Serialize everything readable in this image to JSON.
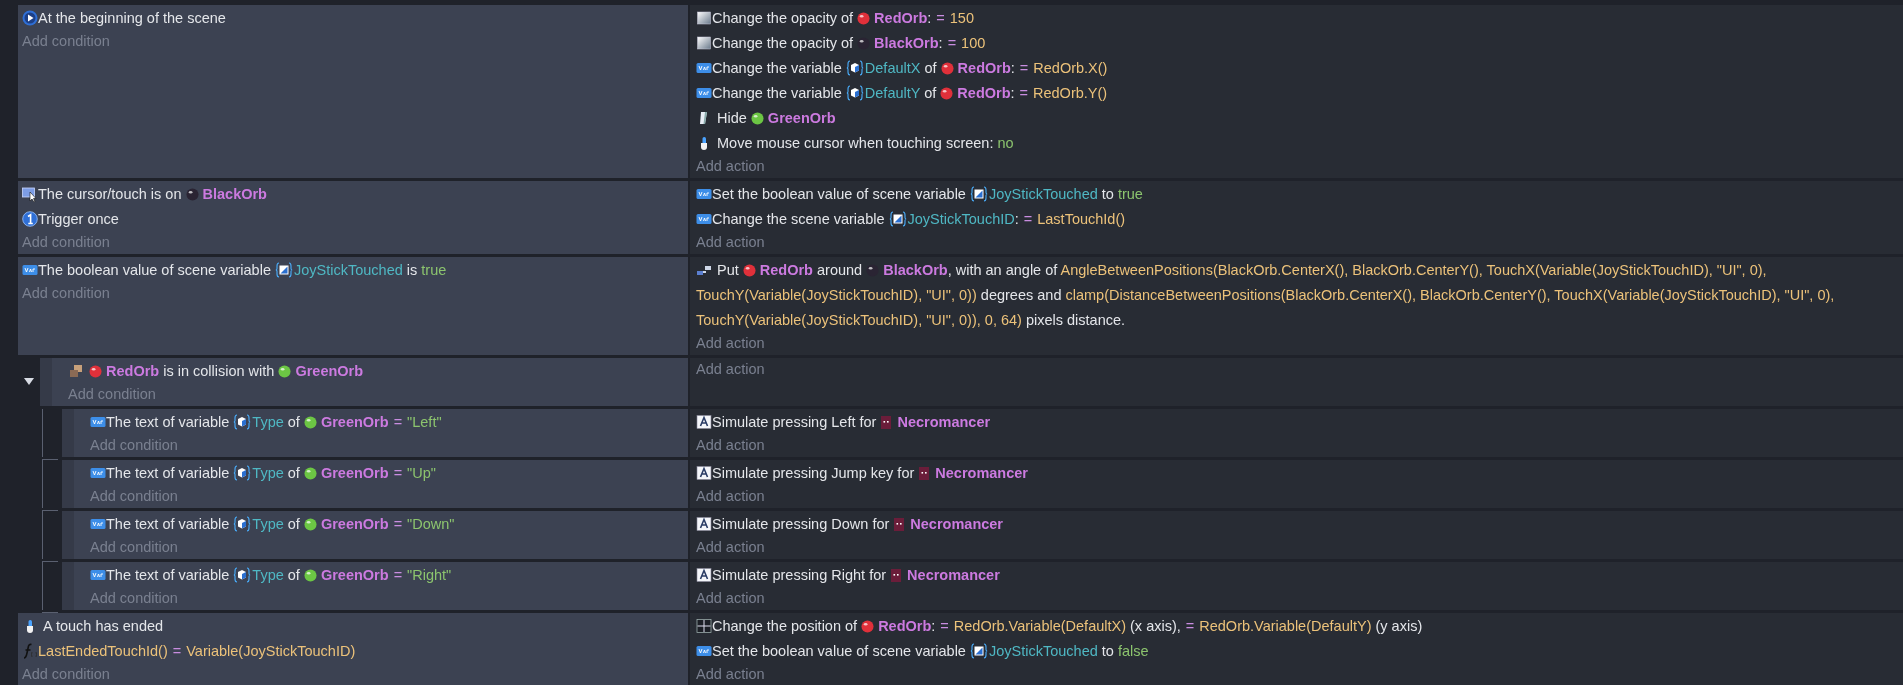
{
  "events": [
    {
      "conditions": [
        {
          "kind": "start",
          "parts": [
            {
              "kind": "text",
              "text": "At the beginning of the scene"
            }
          ]
        }
      ],
      "add_condition": "Add condition",
      "actions": [
        {
          "kind": "opacity",
          "parts": [
            {
              "kind": "text",
              "text": "Change the opacity of "
            },
            {
              "kind": "orb",
              "text": "RedOrb",
              "color": "#e0303a"
            },
            {
              "kind": "text",
              "text": ":"
            },
            {
              "kind": "op",
              "text": "="
            },
            {
              "kind": "expr",
              "text": "150"
            }
          ]
        },
        {
          "kind": "opacity",
          "parts": [
            {
              "kind": "text",
              "text": "Change the opacity of "
            },
            {
              "kind": "orb",
              "text": "BlackOrb",
              "color": "#2a2433"
            },
            {
              "kind": "text",
              "text": ":"
            },
            {
              "kind": "op",
              "text": "="
            },
            {
              "kind": "expr",
              "text": "100"
            }
          ]
        },
        {
          "kind": "variable",
          "parts": [
            {
              "kind": "text",
              "text": "Change the variable "
            },
            {
              "kind": "objvar",
              "text": "DefaultX"
            },
            {
              "kind": "text",
              "text": " of "
            },
            {
              "kind": "orb",
              "text": "RedOrb",
              "color": "#e0303a"
            },
            {
              "kind": "text",
              "text": ":"
            },
            {
              "kind": "op",
              "text": "="
            },
            {
              "kind": "expr",
              "text": "RedOrb.X()"
            }
          ]
        },
        {
          "kind": "variable",
          "parts": [
            {
              "kind": "text",
              "text": "Change the variable "
            },
            {
              "kind": "objvar",
              "text": "DefaultY"
            },
            {
              "kind": "text",
              "text": " of "
            },
            {
              "kind": "orb",
              "text": "RedOrb",
              "color": "#e0303a"
            },
            {
              "kind": "text",
              "text": ":"
            },
            {
              "kind": "op",
              "text": "="
            },
            {
              "kind": "expr",
              "text": "RedOrb.Y()"
            }
          ]
        },
        {
          "kind": "hide",
          "parts": [
            {
              "kind": "text",
              "text": "Hide "
            },
            {
              "kind": "orb",
              "text": "GreenOrb",
              "color": "#6cc644"
            }
          ]
        },
        {
          "kind": "touch",
          "parts": [
            {
              "kind": "text",
              "text": "Move mouse cursor when touching screen: "
            },
            {
              "kind": "value",
              "text": "no"
            }
          ]
        }
      ],
      "add_action": "Add action"
    },
    {
      "conditions": [
        {
          "kind": "cursor",
          "parts": [
            {
              "kind": "text",
              "text": "The cursor/touch is on "
            },
            {
              "kind": "orb",
              "text": "BlackOrb",
              "color": "#2a2433"
            }
          ]
        },
        {
          "kind": "once",
          "parts": [
            {
              "kind": "text",
              "text": "Trigger once"
            }
          ]
        }
      ],
      "add_condition": "Add condition",
      "actions": [
        {
          "kind": "variable",
          "parts": [
            {
              "kind": "text",
              "text": "Set the boolean value of scene variable "
            },
            {
              "kind": "scenevar",
              "text": "JoyStickTouched"
            },
            {
              "kind": "text",
              "text": " to "
            },
            {
              "kind": "value",
              "text": "true"
            }
          ]
        },
        {
          "kind": "variable",
          "parts": [
            {
              "kind": "text",
              "text": "Change the scene variable "
            },
            {
              "kind": "scenevar",
              "text": "JoyStickTouchID"
            },
            {
              "kind": "text",
              "text": ":"
            },
            {
              "kind": "op",
              "text": "="
            },
            {
              "kind": "expr",
              "text": "LastTouchId()"
            }
          ]
        }
      ],
      "add_action": "Add action"
    },
    {
      "conditions": [
        {
          "kind": "variable",
          "parts": [
            {
              "kind": "text",
              "text": "The boolean value of scene variable "
            },
            {
              "kind": "scenevar",
              "text": "JoyStickTouched"
            },
            {
              "kind": "text",
              "text": " is "
            },
            {
              "kind": "value",
              "text": "true"
            }
          ]
        }
      ],
      "add_condition": "Add condition",
      "actions": [
        {
          "kind": "around",
          "parts": [
            {
              "kind": "text",
              "text": "Put "
            },
            {
              "kind": "orb",
              "text": "RedOrb",
              "color": "#e0303a"
            },
            {
              "kind": "text",
              "text": " around "
            },
            {
              "kind": "orb",
              "text": "BlackOrb",
              "color": "#2a2433"
            },
            {
              "kind": "text",
              "text": ", with an angle of "
            },
            {
              "kind": "expr",
              "text": "AngleBetweenPositions(BlackOrb.CenterX(), BlackOrb.CenterY(), TouchX(Variable(JoyStickTouchID), \"UI\", 0), TouchY(Variable(JoyStickTouchID), \"UI\", 0))"
            },
            {
              "kind": "text",
              "text": " degrees and "
            },
            {
              "kind": "expr",
              "text": "clamp(DistanceBetweenPositions(BlackOrb.CenterX(), BlackOrb.CenterY(), TouchX(Variable(JoyStickTouchID), \"UI\", 0), TouchY(Variable(JoyStickTouchID), \"UI\", 0)), 0, 64)"
            },
            {
              "kind": "text",
              "text": " pixels distance."
            }
          ]
        }
      ],
      "add_action": "Add action",
      "expanded": true,
      "children": [
        {
          "conditions": [
            {
              "kind": "collision",
              "parts": [
                {
                  "kind": "orb",
                  "text": "RedOrb",
                  "color": "#e0303a"
                },
                {
                  "kind": "text",
                  "text": " is in collision with "
                },
                {
                  "kind": "orb",
                  "text": "GreenOrb",
                  "color": "#6cc644"
                }
              ]
            }
          ],
          "add_condition": "Add condition",
          "add_action": "Add action",
          "children": [
            {
              "conditions": [
                {
                  "kind": "variable",
                  "parts": [
                    {
                      "kind": "text",
                      "text": "The text of variable "
                    },
                    {
                      "kind": "objvar",
                      "text": "Type"
                    },
                    {
                      "kind": "text",
                      "text": " of "
                    },
                    {
                      "kind": "orb",
                      "text": "GreenOrb",
                      "color": "#6cc644"
                    },
                    {
                      "kind": "op",
                      "text": "="
                    },
                    {
                      "kind": "value",
                      "text": "\"Left\""
                    }
                  ]
                }
              ],
              "add_condition": "Add condition",
              "actions": [
                {
                  "kind": "keyboard",
                  "parts": [
                    {
                      "kind": "text",
                      "text": "Simulate pressing Left for "
                    },
                    {
                      "kind": "sprite",
                      "text": "Necromancer"
                    }
                  ]
                }
              ],
              "add_action": "Add action"
            },
            {
              "conditions": [
                {
                  "kind": "variable",
                  "parts": [
                    {
                      "kind": "text",
                      "text": "The text of variable "
                    },
                    {
                      "kind": "objvar",
                      "text": "Type"
                    },
                    {
                      "kind": "text",
                      "text": " of "
                    },
                    {
                      "kind": "orb",
                      "text": "GreenOrb",
                      "color": "#6cc644"
                    },
                    {
                      "kind": "op",
                      "text": "="
                    },
                    {
                      "kind": "value",
                      "text": "\"Up\""
                    }
                  ]
                }
              ],
              "add_condition": "Add condition",
              "actions": [
                {
                  "kind": "keyboard",
                  "parts": [
                    {
                      "kind": "text",
                      "text": "Simulate pressing Jump key for "
                    },
                    {
                      "kind": "sprite",
                      "text": "Necromancer"
                    }
                  ]
                }
              ],
              "add_action": "Add action"
            },
            {
              "conditions": [
                {
                  "kind": "variable",
                  "parts": [
                    {
                      "kind": "text",
                      "text": "The text of variable "
                    },
                    {
                      "kind": "objvar",
                      "text": "Type"
                    },
                    {
                      "kind": "text",
                      "text": " of "
                    },
                    {
                      "kind": "orb",
                      "text": "GreenOrb",
                      "color": "#6cc644"
                    },
                    {
                      "kind": "op",
                      "text": "="
                    },
                    {
                      "kind": "value",
                      "text": "\"Down\""
                    }
                  ]
                }
              ],
              "add_condition": "Add condition",
              "actions": [
                {
                  "kind": "keyboard",
                  "parts": [
                    {
                      "kind": "text",
                      "text": "Simulate pressing Down for "
                    },
                    {
                      "kind": "sprite",
                      "text": "Necromancer"
                    }
                  ]
                }
              ],
              "add_action": "Add action"
            },
            {
              "conditions": [
                {
                  "kind": "variable",
                  "parts": [
                    {
                      "kind": "text",
                      "text": "The text of variable "
                    },
                    {
                      "kind": "objvar",
                      "text": "Type"
                    },
                    {
                      "kind": "text",
                      "text": " of "
                    },
                    {
                      "kind": "orb",
                      "text": "GreenOrb",
                      "color": "#6cc644"
                    },
                    {
                      "kind": "op",
                      "text": "="
                    },
                    {
                      "kind": "value",
                      "text": "\"Right\""
                    }
                  ]
                }
              ],
              "add_condition": "Add condition",
              "actions": [
                {
                  "kind": "keyboard",
                  "parts": [
                    {
                      "kind": "text",
                      "text": "Simulate pressing Right for "
                    },
                    {
                      "kind": "sprite",
                      "text": "Necromancer"
                    }
                  ]
                }
              ],
              "add_action": "Add action"
            }
          ]
        }
      ]
    },
    {
      "conditions": [
        {
          "kind": "touch",
          "parts": [
            {
              "kind": "text",
              "text": "A touch has ended"
            }
          ]
        },
        {
          "kind": "function",
          "parts": [
            {
              "kind": "expr",
              "text": "LastEndedTouchId()"
            },
            {
              "kind": "op",
              "text": "="
            },
            {
              "kind": "expr",
              "text": "Variable(JoyStickTouchID)"
            }
          ]
        }
      ],
      "add_condition": "Add condition",
      "actions": [
        {
          "kind": "position",
          "parts": [
            {
              "kind": "text",
              "text": "Change the position of "
            },
            {
              "kind": "orb",
              "text": "RedOrb",
              "color": "#e0303a"
            },
            {
              "kind": "text",
              "text": ":"
            },
            {
              "kind": "op",
              "text": "="
            },
            {
              "kind": "expr",
              "text": "RedOrb.Variable(DefaultX)"
            },
            {
              "kind": "text",
              "text": " (x axis),"
            },
            {
              "kind": "op",
              "text": "="
            },
            {
              "kind": "expr",
              "text": "RedOrb.Variable(DefaultY)"
            },
            {
              "kind": "text",
              "text": " (y axis)"
            }
          ]
        },
        {
          "kind": "variable",
          "parts": [
            {
              "kind": "text",
              "text": "Set the boolean value of scene variable "
            },
            {
              "kind": "scenevar",
              "text": "JoyStickTouched"
            },
            {
              "kind": "text",
              "text": " to "
            },
            {
              "kind": "value",
              "text": "false"
            }
          ]
        }
      ],
      "add_action": "Add action"
    }
  ]
}
